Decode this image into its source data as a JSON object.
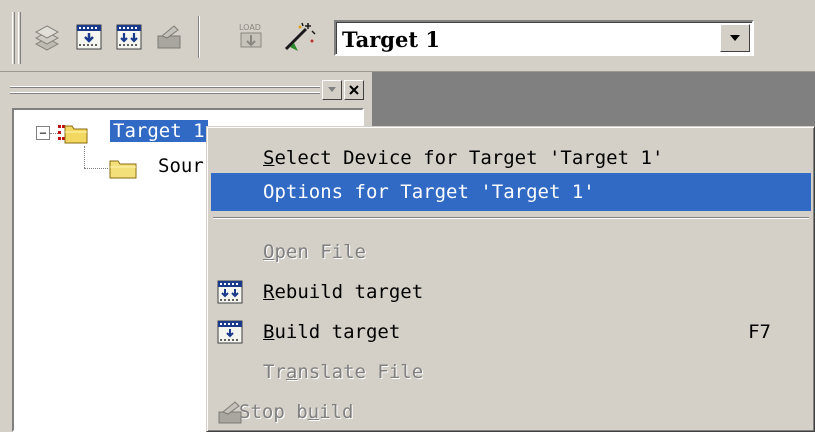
{
  "toolbar": {
    "load_label": "LOAD",
    "target_select": {
      "value": "Target 1"
    }
  },
  "project_tree": {
    "root": {
      "label": "Target 1"
    },
    "child": {
      "label": "Sour"
    }
  },
  "context_menu": {
    "items": [
      {
        "prefix": "",
        "mnemonic": "S",
        "rest": "elect Device for Target 'Target 1'",
        "state": "normal"
      },
      {
        "prefix": "",
        "mnemonic": "",
        "rest": "Options for Target 'Target 1'",
        "state": "highlighted"
      },
      {
        "prefix": "",
        "mnemonic": "O",
        "rest": "pen File",
        "state": "disabled"
      },
      {
        "prefix": "",
        "mnemonic": "R",
        "rest": "ebuild target",
        "state": "normal",
        "icon": "rebuild-icon"
      },
      {
        "prefix": "",
        "mnemonic": "B",
        "rest": "uild target",
        "state": "normal",
        "icon": "build-icon",
        "shortcut": "F7"
      },
      {
        "prefix": "Tr",
        "mnemonic": "a",
        "rest": "nslate File",
        "state": "disabled"
      },
      {
        "prefix": "Stop b",
        "mnemonic": "u",
        "rest": "ild",
        "state": "disabled",
        "icon": "stop-build-icon"
      }
    ]
  },
  "colors": {
    "highlight": "#316ac5",
    "face": "#d4d0c8",
    "editor_bg": "#808080"
  }
}
